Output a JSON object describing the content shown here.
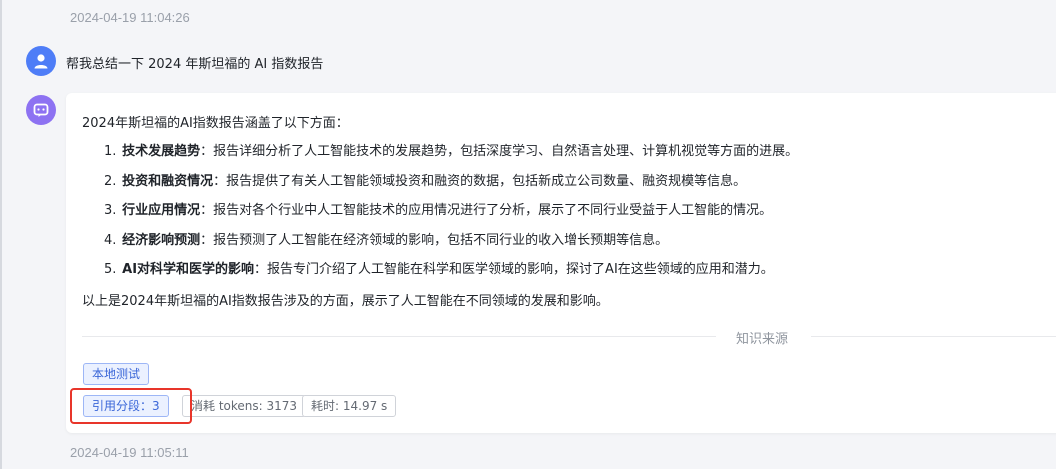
{
  "timestamps": {
    "top": "2024-04-19 11:04:26",
    "bottom": "2024-04-19 11:05:11"
  },
  "user_message": {
    "avatar_icon": "user-icon",
    "text": "帮我总结一下 2024 年斯坦福的 AI 指数报告"
  },
  "bot_message": {
    "avatar_icon": "robot-icon",
    "intro": "2024年斯坦福的AI指数报告涵盖了以下方面：",
    "items": [
      {
        "num": "1.",
        "term": "技术发展趋势",
        "desc": "：报告详细分析了人工智能技术的发展趋势，包括深度学习、自然语言处理、计算机视觉等方面的进展。"
      },
      {
        "num": "2.",
        "term": "投资和融资情况",
        "desc": "：报告提供了有关人工智能领域投资和融资的数据，包括新成立公司数量、融资规模等信息。"
      },
      {
        "num": "3.",
        "term": "行业应用情况",
        "desc": "：报告对各个行业中人工智能技术的应用情况进行了分析，展示了不同行业受益于人工智能的情况。"
      },
      {
        "num": "4.",
        "term": "经济影响预测",
        "desc": "：报告预测了人工智能在经济领域的影响，包括不同行业的收入增长预期等信息。"
      },
      {
        "num": "5.",
        "term": "AI对科学和医学的影响",
        "desc": "：报告专门介绍了人工智能在科学和医学领域的影响，探讨了AI在这些领域的应用和潜力。"
      }
    ],
    "summary": "以上是2024年斯坦福的AI指数报告涉及的方面，展示了人工智能在不同领域的发展和影响。",
    "knowledge_title": "知识来源",
    "source_tag": "本地测试",
    "refs_tag": "引用分段：3",
    "tokens_tag": "消耗 tokens: 3173",
    "time_tag": "耗时: 14.97 s"
  },
  "colors": {
    "accent": "#3a66d8",
    "highlight": "#e8352a",
    "user_avatar": "#4e7df7",
    "bot_avatar": "#8d72f2"
  }
}
